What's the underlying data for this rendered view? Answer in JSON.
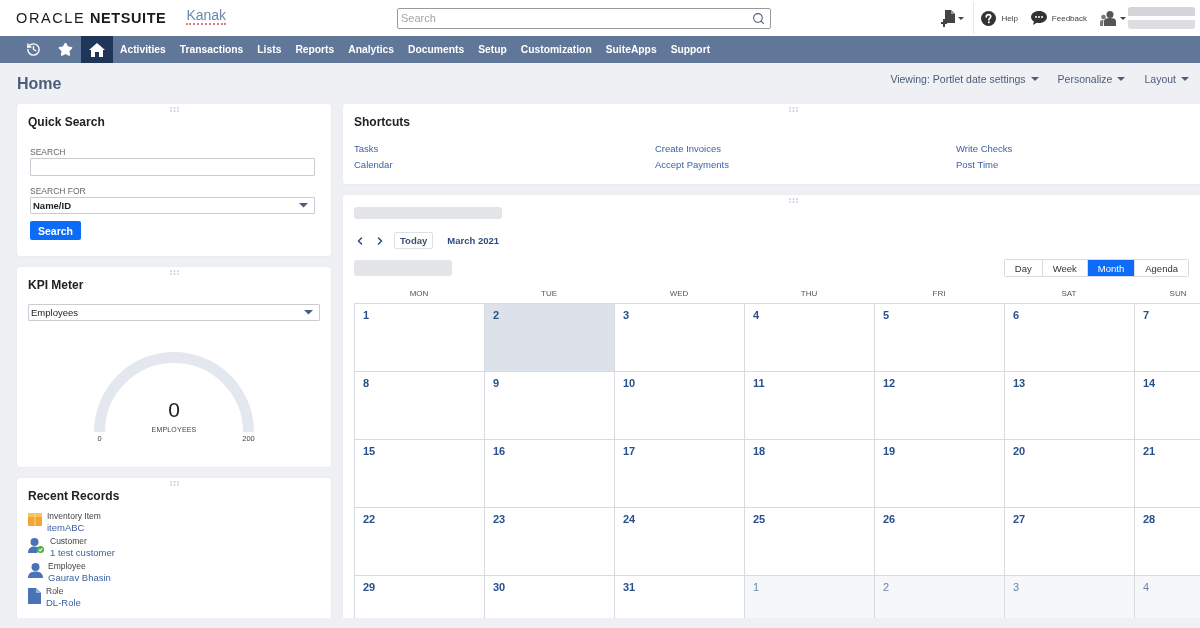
{
  "header": {
    "logo": {
      "brand": "ORACLE",
      "product": "NETSUITE"
    },
    "company_logo": "Kanak",
    "search": {
      "placeholder": "Search"
    },
    "links": [
      {
        "kind": "help",
        "label": "Help"
      },
      {
        "kind": "feedback",
        "label": "Feedback"
      }
    ]
  },
  "nav": [
    {
      "kind": "recent",
      "selected": false
    },
    {
      "kind": "favorites",
      "selected": false
    },
    {
      "kind": "home",
      "selected": true
    },
    {
      "kind": "menu",
      "label": "Activities",
      "selected": false
    },
    {
      "kind": "menu",
      "label": "Transactions",
      "selected": false
    },
    {
      "kind": "menu",
      "label": "Lists",
      "selected": false
    },
    {
      "kind": "menu",
      "label": "Reports",
      "selected": false
    },
    {
      "kind": "menu",
      "label": "Analytics",
      "selected": false
    },
    {
      "kind": "menu",
      "label": "Documents",
      "selected": false
    },
    {
      "kind": "menu",
      "label": "Setup",
      "selected": false
    },
    {
      "kind": "menu",
      "label": "Customization",
      "selected": false
    },
    {
      "kind": "menu",
      "label": "SuiteApps",
      "selected": false
    },
    {
      "kind": "menu",
      "label": "Support",
      "selected": false
    }
  ],
  "page": {
    "title": "Home",
    "menus": [
      "Viewing: Portlet date settings",
      "Personalize",
      "Layout"
    ]
  },
  "quick_search": {
    "title": "Quick Search",
    "search_label": "SEARCH",
    "search_for_label": "SEARCH FOR",
    "search_for_value": "Name/ID",
    "button": "Search"
  },
  "kpi_meter": {
    "title": "KPI Meter",
    "metric": "Employees",
    "value": "0",
    "unit": "EMPLOYEES",
    "min": "0",
    "max": "200"
  },
  "recent_records": {
    "title": "Recent Records",
    "items": [
      {
        "kind": "item",
        "type": "Inventory Item",
        "name": "itemABC"
      },
      {
        "kind": "customer",
        "type": "Customer",
        "name": "1 test customer"
      },
      {
        "kind": "employee",
        "type": "Employee",
        "name": "Gaurav Bhasin"
      },
      {
        "kind": "role",
        "type": "Role",
        "name": "DL-Role"
      }
    ]
  },
  "shortcuts": {
    "title": "Shortcuts",
    "links": [
      "Tasks",
      "Calendar",
      "Create Invoices",
      "Accept Payments",
      "Write Checks",
      "Post Time"
    ]
  },
  "calendar": {
    "today_button": "Today",
    "period": "March 2021",
    "views": [
      {
        "label": "Day",
        "selected": false
      },
      {
        "label": "Week",
        "selected": false
      },
      {
        "label": "Month",
        "selected": true
      },
      {
        "label": "Agenda",
        "selected": false
      }
    ],
    "weekdays": [
      "MON",
      "TUE",
      "WED",
      "THU",
      "FRI",
      "SAT",
      "SUN"
    ],
    "weeks": [
      [
        {
          "day": "1",
          "today": false,
          "other_month": false
        },
        {
          "day": "2",
          "today": true,
          "other_month": false
        },
        {
          "day": "3",
          "today": false,
          "other_month": false
        },
        {
          "day": "4",
          "today": false,
          "other_month": false
        },
        {
          "day": "5",
          "today": false,
          "other_month": false
        },
        {
          "day": "6",
          "today": false,
          "other_month": false
        },
        {
          "day": "7",
          "today": false,
          "other_month": false
        }
      ],
      [
        {
          "day": "8",
          "today": false,
          "other_month": false
        },
        {
          "day": "9",
          "today": false,
          "other_month": false
        },
        {
          "day": "10",
          "today": false,
          "other_month": false
        },
        {
          "day": "11",
          "today": false,
          "other_month": false
        },
        {
          "day": "12",
          "today": false,
          "other_month": false
        },
        {
          "day": "13",
          "today": false,
          "other_month": false
        },
        {
          "day": "14",
          "today": false,
          "other_month": false
        }
      ],
      [
        {
          "day": "15",
          "today": false,
          "other_month": false
        },
        {
          "day": "16",
          "today": false,
          "other_month": false
        },
        {
          "day": "17",
          "today": false,
          "other_month": false
        },
        {
          "day": "18",
          "today": false,
          "other_month": false
        },
        {
          "day": "19",
          "today": false,
          "other_month": false
        },
        {
          "day": "20",
          "today": false,
          "other_month": false
        },
        {
          "day": "21",
          "today": false,
          "other_month": false
        }
      ],
      [
        {
          "day": "22",
          "today": false,
          "other_month": false
        },
        {
          "day": "23",
          "today": false,
          "other_month": false
        },
        {
          "day": "24",
          "today": false,
          "other_month": false
        },
        {
          "day": "25",
          "today": false,
          "other_month": false
        },
        {
          "day": "26",
          "today": false,
          "other_month": false
        },
        {
          "day": "27",
          "today": false,
          "other_month": false
        },
        {
          "day": "28",
          "today": false,
          "other_month": false
        }
      ],
      [
        {
          "day": "29",
          "today": false,
          "other_month": false
        },
        {
          "day": "30",
          "today": false,
          "other_month": false
        },
        {
          "day": "31",
          "today": false,
          "other_month": false
        },
        {
          "day": "1",
          "today": false,
          "other_month": true
        },
        {
          "day": "2",
          "today": false,
          "other_month": true
        },
        {
          "day": "3",
          "today": false,
          "other_month": true
        },
        {
          "day": "4",
          "today": false,
          "other_month": true
        }
      ]
    ]
  }
}
